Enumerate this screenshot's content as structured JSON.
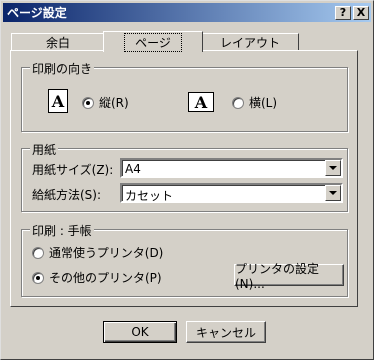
{
  "window": {
    "title": "ページ設定",
    "help_label": "?",
    "close_label": "X"
  },
  "tabs": [
    {
      "label": "余白",
      "active": false
    },
    {
      "label": "ページ",
      "active": true
    },
    {
      "label": "レイアウト",
      "active": false
    }
  ],
  "orientation": {
    "legend": "印刷の向き",
    "portrait": {
      "icon_letter": "A",
      "label": "縦(R)",
      "selected": true
    },
    "landscape": {
      "icon_letter": "A",
      "label": "横(L)",
      "selected": false
    }
  },
  "paper": {
    "legend": "用紙",
    "size_label": "用紙サイズ(Z):",
    "size_value": "A4",
    "source_label": "給紙方法(S):",
    "source_value": "カセット"
  },
  "printer": {
    "legend": "印刷 : 手帳",
    "default_label": "通常使うプリンタ(D)",
    "default_selected": false,
    "other_label": "その他のプリンタ(P)",
    "other_selected": true,
    "settings_button": "プリンタの設定(N)..."
  },
  "footer": {
    "ok_label": "OK",
    "cancel_label": "キャンセル"
  }
}
